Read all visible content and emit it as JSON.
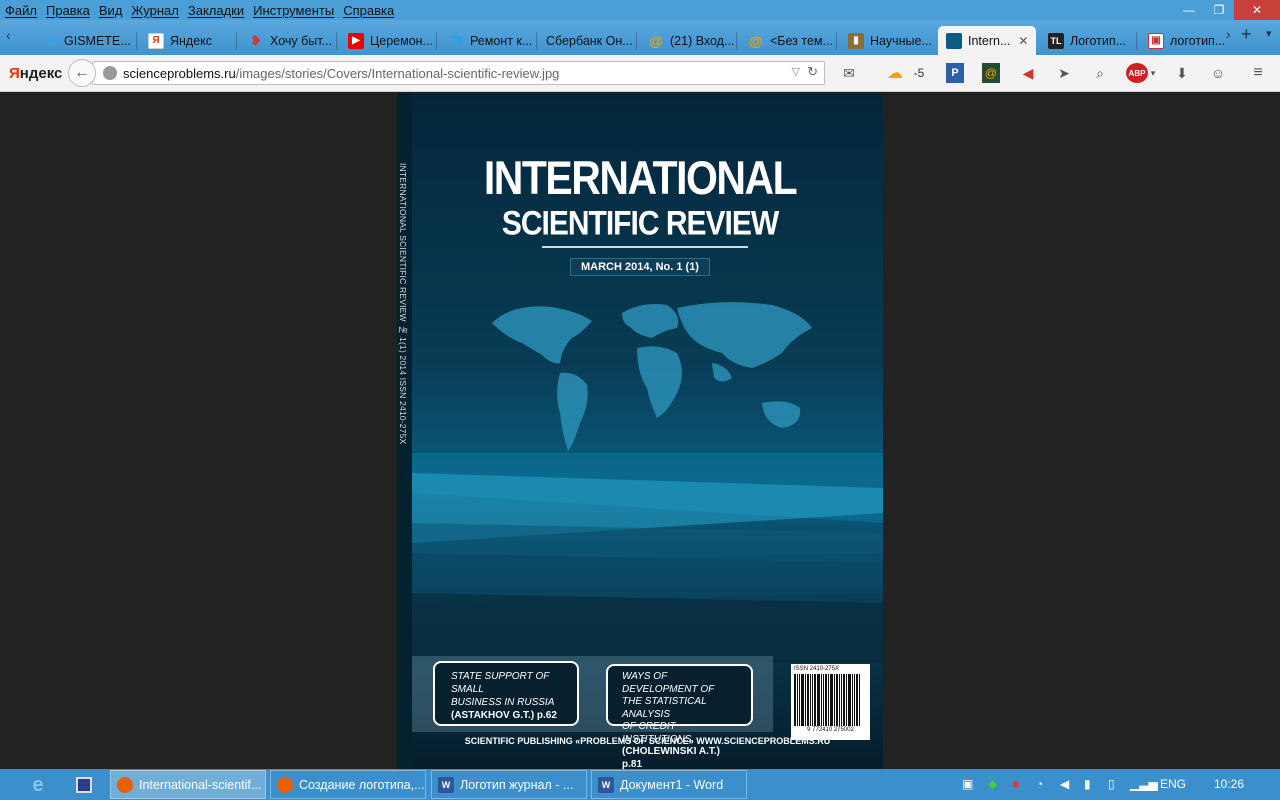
{
  "menu": [
    "Файл",
    "Правка",
    "Вид",
    "Журнал",
    "Закладки",
    "Инструменты",
    "Справка"
  ],
  "tabs": [
    {
      "label": "GISMETE...",
      "icon": "gismeteo-icon",
      "color": "#3aa0e0"
    },
    {
      "label": "Яндекс",
      "icon": "yandex-icon",
      "color": "#e30"
    },
    {
      "label": "Хочу быт...",
      "icon": "heart-icon",
      "color": "#d33"
    },
    {
      "label": "Церемон...",
      "icon": "youtube-icon",
      "color": "#e00"
    },
    {
      "label": "Ремонт к...",
      "icon": "bird-icon",
      "color": "#29a3e0"
    },
    {
      "label": "Сбербанк Он...",
      "icon": "",
      "color": ""
    },
    {
      "label": "(21) Вход...",
      "icon": "mail-at-icon",
      "color": "#f2a300"
    },
    {
      "label": "<Без тем...",
      "icon": "mail-at-icon",
      "color": "#f2a300"
    },
    {
      "label": "Научные...",
      "icon": "book-icon",
      "color": "#8a6d3b"
    },
    {
      "label": "Intern...",
      "icon": "cover-thumb-icon",
      "color": "#0a5d80",
      "active": true
    },
    {
      "label": "Логотип...",
      "icon": "tl-icon",
      "color": "#222"
    },
    {
      "label": "логотип...",
      "icon": "image-icon",
      "color": "#c33"
    }
  ],
  "nav": {
    "logo_a": "Я",
    "logo_b": "ндекс",
    "url": "scienceproblems.ru/images/stories/Covers/International-scientific-review.jpg",
    "url_domain": "scienceproblems.ru",
    "url_path": "/images/stories/Covers/International-scientific-review.jpg",
    "weather": "-5"
  },
  "cover": {
    "title_line1": "INTERNATIONAL",
    "title_line2": "SCIENTIFIC REVIEW",
    "issue": "MARCH 2014, No. 1 (1)",
    "spine": "INTERNATIONAL SCIENTIFIC REVIEW   № 1(1) 2014    ISSN 2410-275X",
    "box1": {
      "l1": "STATE SUPPORT OF SMALL",
      "l2": "BUSINESS IN RUSSIA",
      "l3": "(ASTAKHOV G.T.) p.62"
    },
    "box2": {
      "l1": "WAYS OF DEVELOPMENT OF",
      "l2": "THE STATISTICAL ANALYSIS",
      "l3": "OF CREDIT INSTITUTIONS",
      "l4": "(CHOLEWINSKI A.T.) p.81"
    },
    "issn": "ISSN 2410-275X",
    "barcode_number": "9 772410 275002",
    "footer": "SCIENTIFIC PUBLISHING «PROBLEMS OF SCIENCE» WWW.SCIENCEPROBLEMS.RU"
  },
  "taskbar": {
    "items": [
      {
        "label": "International-scientif...",
        "active": true,
        "color": "#e66000",
        "app": "firefox-icon"
      },
      {
        "label": "Создание логотипа,...",
        "active": false,
        "color": "#e66000",
        "app": "firefox-icon"
      },
      {
        "label": "Логотип журнал - ...",
        "active": false,
        "color": "#2b579a",
        "app": "word-icon"
      },
      {
        "label": "Документ1 - Word",
        "active": false,
        "color": "#2b579a",
        "app": "word-icon"
      }
    ],
    "lang": "ENG",
    "time": "10:26"
  }
}
